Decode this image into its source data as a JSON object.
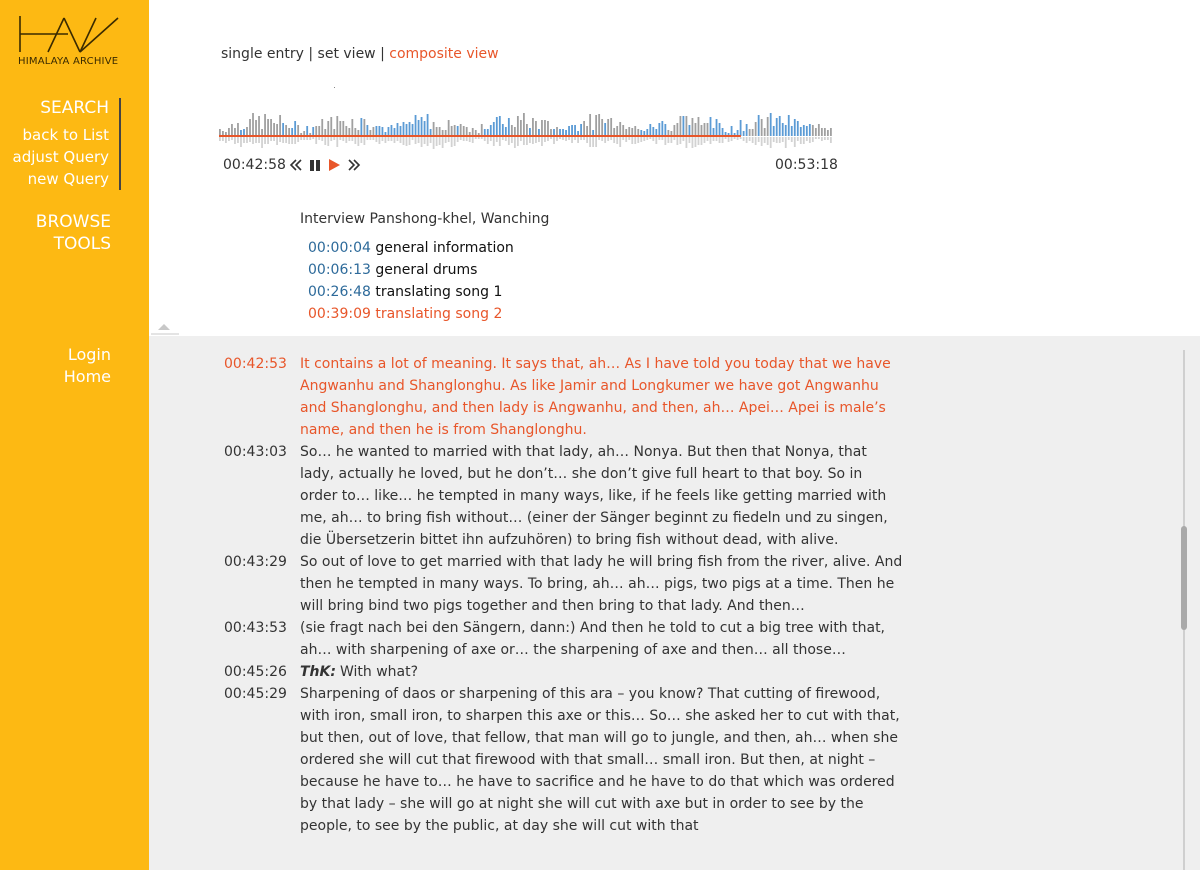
{
  "logo": {
    "mark": "HAV",
    "subtitle": "HIMALAYA ARCHIVE"
  },
  "sidebar": {
    "search": "SEARCH",
    "back_to_list": "back to List",
    "adjust_query": "adjust Query",
    "new_query": "new Query",
    "browse": "BROWSE",
    "tools": "TOOLS",
    "login": "Login",
    "home": "Home"
  },
  "view_switch": {
    "single": "single entry",
    "sep1": " | ",
    "set": "set view",
    "sep2": " | ",
    "composite": "composite view"
  },
  "player": {
    "time_start": "00:42:58",
    "time_end": "00:53:18",
    "progress": 0.85,
    "colors": {
      "accent": "#E8562A",
      "blue": "#5B9BD5",
      "grey": "#A0A0A0"
    }
  },
  "interview": {
    "title": "Interview Panshong-khel, Wanching"
  },
  "chapters": [
    {
      "time": "00:00:04",
      "label": "general information"
    },
    {
      "time": "00:06:13",
      "label": "general drums"
    },
    {
      "time": "00:26:48",
      "label": "translating song 1"
    },
    {
      "time": "00:39:09",
      "label": "translating song 2"
    }
  ],
  "transcript": [
    {
      "time": "00:42:53",
      "speaker": "",
      "text": "It contains a lot of meaning. It says that, ah… As I have told you today that we have Angwanhu and Shanglonghu. As like Jamir and Longkumer we have got Angwanhu and Shanglonghu, and then lady is Angwanhu, and then, ah… Apei… Apei is male’s name, and then he is from Shanglonghu."
    },
    {
      "time": "00:43:03",
      "speaker": "",
      "text": "So… he wanted to married with that lady, ah… Nonya. But then that Nonya, that lady, actually he loved, but he don’t… she don’t give full heart to that boy. So in order to… like… he tempted in many ways, like, if he feels like getting married with me, ah… to bring fish without… (einer der Sänger beginnt zu fiedeln und zu singen, die Übersetzerin bittet ihn aufzuhören) to bring fish without dead, with alive."
    },
    {
      "time": "00:43:29",
      "speaker": "",
      "text": "So out of love to get married with that lady he will bring fish from the river, alive. And then he tempted in many ways. To bring, ah… ah… pigs, two pigs at a time. Then he will bring bind two pigs together and then bring to that lady. And then…"
    },
    {
      "time": "00:43:53",
      "speaker": "",
      "text": "(sie fragt nach bei den Sängern, dann:) And then he told to cut a big tree with that, ah… with sharpening of axe or… the sharpening of axe and then… all those…"
    },
    {
      "time": "00:45:26",
      "speaker": "ThK:",
      "text": "With what?"
    },
    {
      "time": "00:45:29",
      "speaker": "",
      "text": "Sharpening of daos or sharpening of this ara – you know? That cutting of firewood, with iron, small iron, to sharpen this axe or this… So… she asked her to cut with that, but then, out of love, that fellow, that man will go to jungle, and then, ah… when she ordered she will cut that firewood with that small… small iron. But then, at night – because he have to… he have to sacrifice and he have to do that which was ordered by that lady – she will go at night she will cut with axe but in order to see by the people, to see by the public, at day she will cut with that"
    }
  ]
}
